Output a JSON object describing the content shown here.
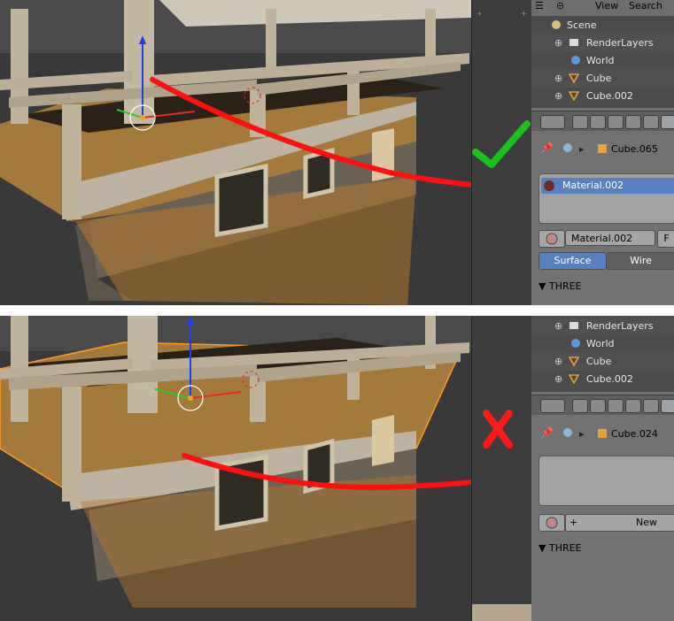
{
  "top_panel": {
    "outliner_header": {
      "view_label": "View",
      "search_label": "Search"
    },
    "outliner_items": [
      {
        "label": "Scene",
        "icon": "scene-icon"
      },
      {
        "label": "RenderLayers",
        "icon": "render-layers-icon"
      },
      {
        "label": "World",
        "icon": "world-icon"
      },
      {
        "label": "Cube",
        "icon": "mesh-object-icon"
      },
      {
        "label": "Cube.002",
        "icon": "mesh-object-icon"
      }
    ],
    "object_name": "Cube.065",
    "material_slot": "Material.002",
    "material_field": "Material.002",
    "fake_user_label": "F",
    "diffuse_buttons": [
      "Surface",
      "Wire"
    ],
    "section_label": "THREE",
    "verdict_symbol": "✓",
    "verdict_color": "#18c218"
  },
  "bottom_panel": {
    "outliner_items": [
      {
        "label": "RenderLayers",
        "icon": "render-layers-icon"
      },
      {
        "label": "World",
        "icon": "world-icon"
      },
      {
        "label": "Cube",
        "icon": "mesh-object-icon"
      },
      {
        "label": "Cube.002",
        "icon": "mesh-object-icon"
      }
    ],
    "object_name": "Cube.024",
    "new_button_label": "New",
    "section_label": "THREE",
    "verdict_symbol": "X",
    "verdict_color": "#ff1a1a"
  },
  "colors": {
    "annotation_stroke": "#ff1010",
    "selection_highlight": "#5680c2",
    "viewport_bg": "#393939",
    "wood": "#8a6a3a"
  }
}
